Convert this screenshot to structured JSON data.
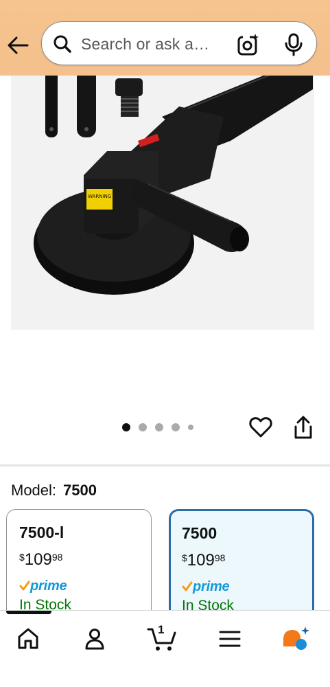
{
  "header": {
    "back_icon": "back-arrow-icon",
    "search_placeholder": "Search or ask a…",
    "camera_icon": "camera-lens-icon",
    "mic_icon": "microphone-icon",
    "background_color": "#f5c28d"
  },
  "gallery": {
    "image_alt": "Black pneumatic angle polisher with side handle and backing pad",
    "image_count": 5,
    "active_index": 0,
    "wishlist_icon": "heart-icon",
    "share_icon": "share-icon"
  },
  "variation": {
    "label": "Model:",
    "selected": "7500",
    "options": [
      {
        "name": "7500-l",
        "price_symbol": "$",
        "price_whole": "109",
        "price_fraction": "98",
        "prime": "prime",
        "stock": "In Stock",
        "selected": false
      },
      {
        "name": "7500",
        "price_symbol": "$",
        "price_whole": "109",
        "price_fraction": "98",
        "prime": "prime",
        "stock": "In Stock",
        "selected": true
      }
    ]
  },
  "bottom_nav": {
    "items": [
      {
        "name": "home-icon"
      },
      {
        "name": "account-icon"
      },
      {
        "name": "cart-icon",
        "count": "1"
      },
      {
        "name": "menu-icon"
      },
      {
        "name": "rufus-icon"
      }
    ]
  },
  "colors": {
    "accent_blue": "#2c6da7",
    "prime_blue": "#1399d6",
    "prime_check": "#f79a1c",
    "stock_green": "#007600"
  }
}
